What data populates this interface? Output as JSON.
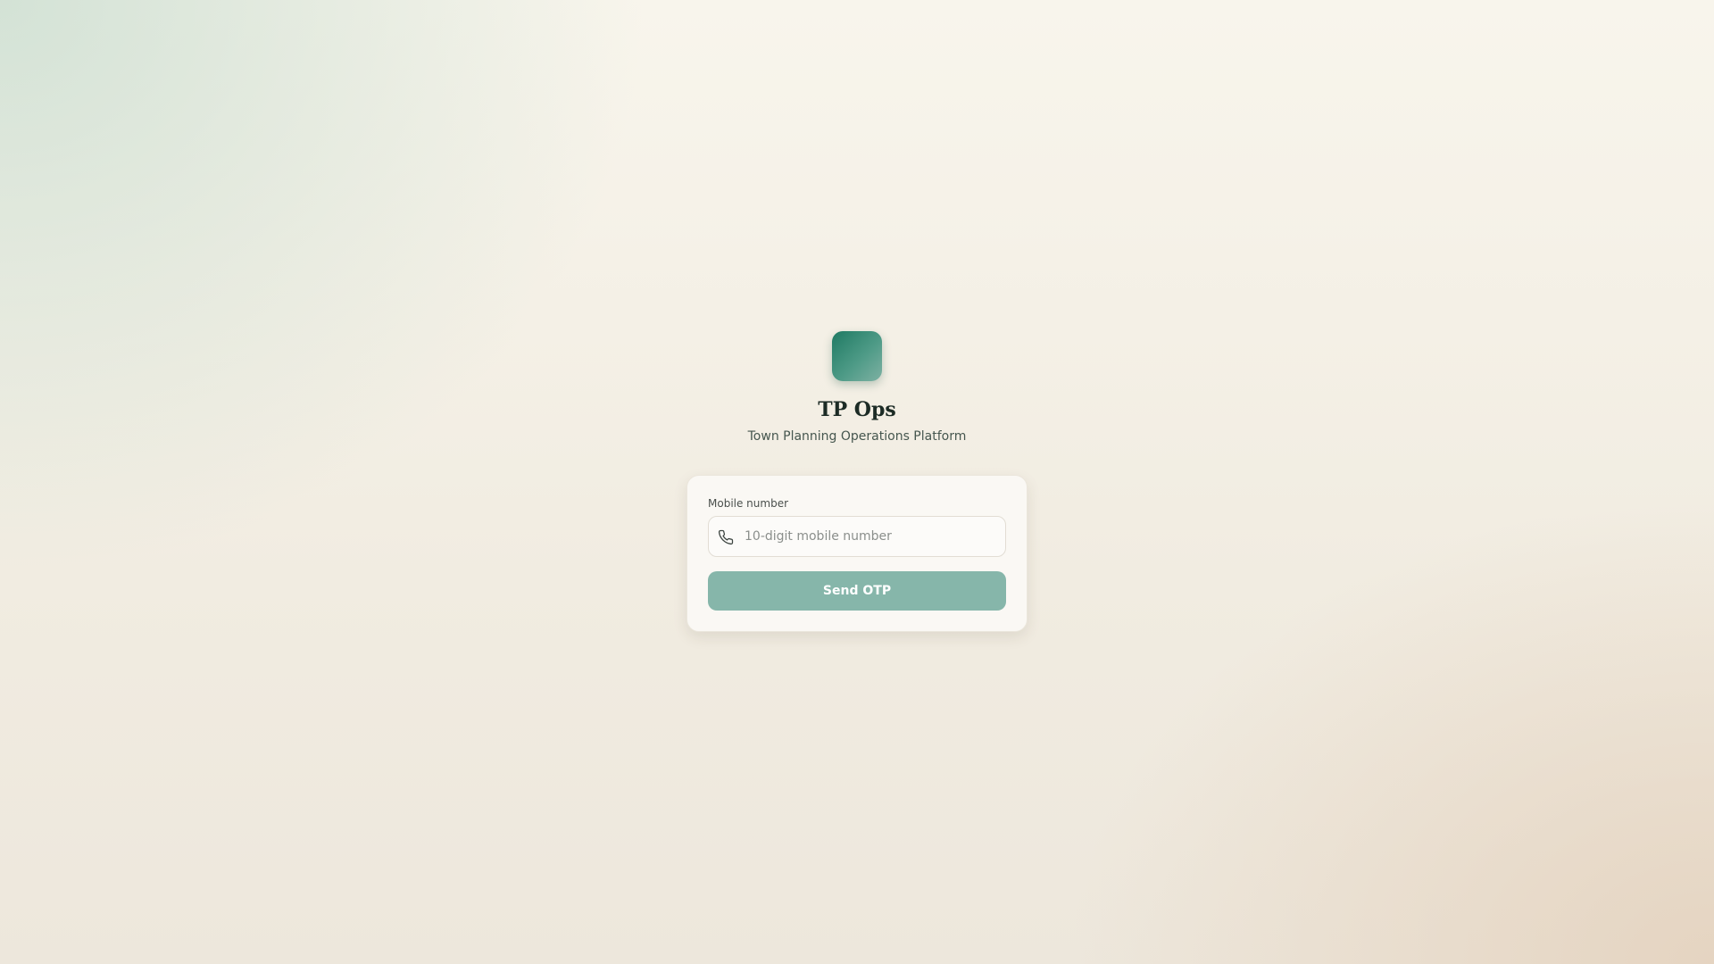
{
  "brand": {
    "name": "TP Ops",
    "tagline": "Town Planning Operations Platform",
    "logo_icon": "app-logo",
    "accent_color": "#1f7a63"
  },
  "login_form": {
    "mobile_label": "Mobile number",
    "mobile_value": "",
    "mobile_placeholder": "10-digit mobile number",
    "mobile_icon": "phone-icon",
    "submit_label": "Send OTP",
    "submit_color": "#86b6aa",
    "submit_enabled": false
  }
}
